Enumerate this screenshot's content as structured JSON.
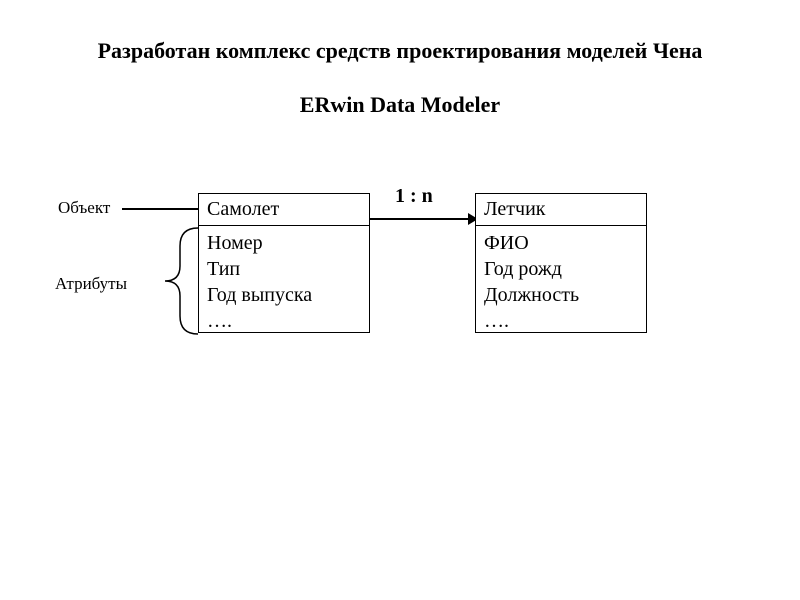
{
  "title": "Разработан комплекс средств проектирования моделей Чена",
  "subtitle": "ERwin  Data Modeler",
  "labels": {
    "object": "Объект",
    "attributes": "Атрибуты",
    "relation": "1 : n"
  },
  "entities": {
    "left": {
      "name": "Самолет",
      "attrs": [
        "Номер",
        "Тип",
        "Год выпуска",
        "…."
      ]
    },
    "right": {
      "name": "Летчик",
      "attrs": [
        "ФИО",
        "Год рожд",
        "Должность",
        "…."
      ]
    }
  },
  "chart_data": {
    "type": "diagram",
    "title": "ERwin Data Modeler - Chen Model Design",
    "entities": [
      {
        "name": "Самолет",
        "attributes": [
          "Номер",
          "Тип",
          "Год выпуска"
        ]
      },
      {
        "name": "Летчик",
        "attributes": [
          "ФИО",
          "Год рожд",
          "Должность"
        ]
      }
    ],
    "relationships": [
      {
        "from": "Самолет",
        "to": "Летчик",
        "cardinality": "1 : n"
      }
    ],
    "annotations": [
      {
        "label": "Объект",
        "target": "entity-header"
      },
      {
        "label": "Атрибуты",
        "target": "entity-body"
      }
    ]
  }
}
